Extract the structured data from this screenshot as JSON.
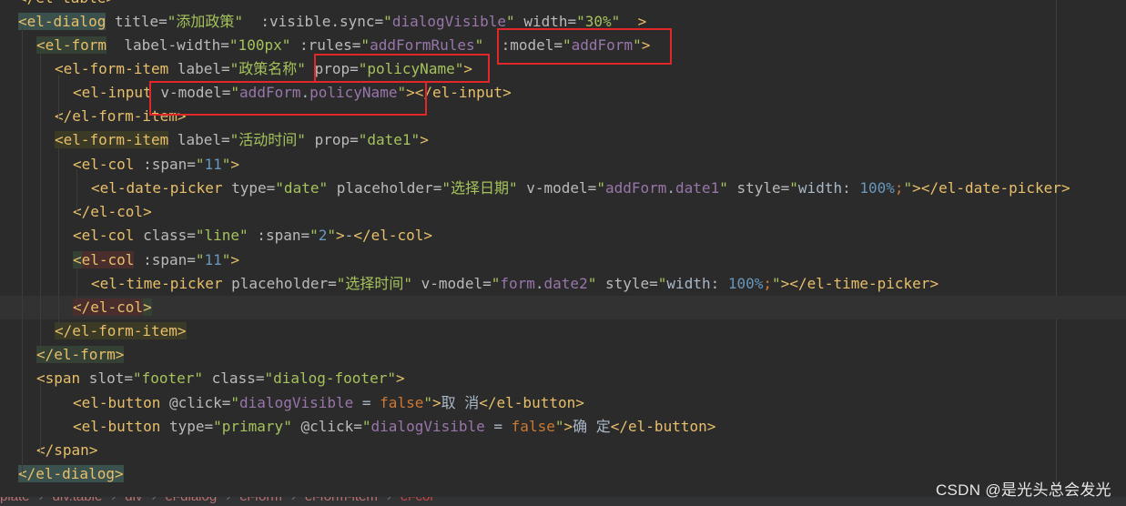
{
  "code_lines": [
    [
      [
        "tok-tag",
        "</el-table>"
      ]
    ],
    [
      [
        "tok-tag hl-match",
        "<el-dialog"
      ],
      [
        "tok-attr",
        " title="
      ],
      [
        "tok-val",
        "\"添加政策\""
      ],
      [
        "tok-attr",
        "  :visible.sync="
      ],
      [
        "tok-val",
        "\""
      ],
      [
        "tok-bind",
        "dialogVisible"
      ],
      [
        "tok-val",
        "\""
      ],
      [
        "tok-attr",
        " width="
      ],
      [
        "tok-val",
        "\"30%\""
      ],
      [
        "tok-attr",
        "  "
      ],
      [
        "tok-tag",
        ">"
      ]
    ],
    [
      [
        "tok-tag hl-green",
        "<el-form"
      ],
      [
        "tok-attr",
        "  label-width="
      ],
      [
        "tok-val",
        "\"100px\""
      ],
      [
        "tok-attr",
        " :rules="
      ],
      [
        "tok-val",
        "\""
      ],
      [
        "tok-bind",
        "addFormRules"
      ],
      [
        "tok-val",
        "\""
      ],
      [
        "tok-attr",
        "  :model="
      ],
      [
        "tok-val",
        "\""
      ],
      [
        "tok-bind",
        "addForm"
      ],
      [
        "tok-val",
        "\""
      ],
      [
        "tok-tag",
        ">"
      ]
    ],
    [
      [
        "tok-tag",
        "<el-form-item"
      ],
      [
        "tok-attr",
        " label="
      ],
      [
        "tok-val",
        "\"政策名称\""
      ],
      [
        "tok-attr",
        " prop="
      ],
      [
        "tok-val",
        "\"policyName\""
      ],
      [
        "tok-tag",
        ">"
      ]
    ],
    [
      [
        "tok-tag",
        "<el-input"
      ],
      [
        "tok-attr",
        " v-model="
      ],
      [
        "tok-val",
        "\""
      ],
      [
        "tok-bind",
        "addForm"
      ],
      [
        "tok-text",
        "."
      ],
      [
        "tok-bind",
        "policyName"
      ],
      [
        "tok-val",
        "\""
      ],
      [
        "tok-tag",
        ">"
      ],
      [
        "tok-tag",
        "</el-input>"
      ]
    ],
    [
      [
        "tok-tag",
        "</el-form-item>"
      ]
    ],
    [
      [
        "tok-tag hl-olive",
        "<el-form-item"
      ],
      [
        "tok-attr",
        " label="
      ],
      [
        "tok-val",
        "\"活动时间\""
      ],
      [
        "tok-attr",
        " prop="
      ],
      [
        "tok-val",
        "\"date1\""
      ],
      [
        "tok-tag",
        ">"
      ]
    ],
    [
      [
        "tok-tag",
        "<el-col"
      ],
      [
        "tok-attr",
        " :span="
      ],
      [
        "tok-val",
        "\""
      ],
      [
        "tok-num",
        "11"
      ],
      [
        "tok-val",
        "\""
      ],
      [
        "tok-tag",
        ">"
      ]
    ],
    [
      [
        "tok-tag",
        "<el-date-picker"
      ],
      [
        "tok-attr",
        " type="
      ],
      [
        "tok-val",
        "\"date\""
      ],
      [
        "tok-attr",
        " placeholder="
      ],
      [
        "tok-val",
        "\"选择日期\""
      ],
      [
        "tok-attr",
        " v-model="
      ],
      [
        "tok-val",
        "\""
      ],
      [
        "tok-bind",
        "addForm"
      ],
      [
        "tok-text",
        "."
      ],
      [
        "tok-bind",
        "date1"
      ],
      [
        "tok-val",
        "\""
      ],
      [
        "tok-attr",
        " style="
      ],
      [
        "tok-val",
        "\""
      ],
      [
        "tok-text",
        "width: "
      ],
      [
        "tok-num",
        "100%"
      ],
      [
        "tok-kw",
        ";"
      ],
      [
        "tok-val",
        "\""
      ],
      [
        "tok-tag",
        ">"
      ],
      [
        "tok-tag",
        "</el-date-picker>"
      ]
    ],
    [
      [
        "tok-tag",
        "</el-col>"
      ]
    ],
    [
      [
        "tok-tag",
        "<el-col"
      ],
      [
        "tok-attr",
        " class="
      ],
      [
        "tok-val",
        "\"line\""
      ],
      [
        "tok-attr",
        " :span="
      ],
      [
        "tok-val",
        "\""
      ],
      [
        "tok-num",
        "2"
      ],
      [
        "tok-val",
        "\""
      ],
      [
        "tok-tag",
        ">"
      ],
      [
        "tok-text",
        "-"
      ],
      [
        "tok-tag",
        "</el-col>"
      ]
    ],
    [
      [
        "tok-tag hl-green",
        "<"
      ],
      [
        "tok-tag hl-red",
        "el-col"
      ],
      [
        "tok-attr",
        " :span="
      ],
      [
        "tok-val",
        "\""
      ],
      [
        "tok-num",
        "11"
      ],
      [
        "tok-val",
        "\""
      ],
      [
        "tok-tag",
        ">"
      ]
    ],
    [
      [
        "tok-tag",
        "<el-time-picker"
      ],
      [
        "tok-attr",
        " placeholder="
      ],
      [
        "tok-val",
        "\"选择时间\""
      ],
      [
        "tok-attr",
        " v-model="
      ],
      [
        "tok-val",
        "\""
      ],
      [
        "tok-bind",
        "form"
      ],
      [
        "tok-text",
        "."
      ],
      [
        "tok-bind",
        "date2"
      ],
      [
        "tok-val",
        "\""
      ],
      [
        "tok-attr",
        " style="
      ],
      [
        "tok-val",
        "\""
      ],
      [
        "tok-text",
        "width: "
      ],
      [
        "tok-num",
        "100%"
      ],
      [
        "tok-kw",
        ";"
      ],
      [
        "tok-val",
        "\""
      ],
      [
        "tok-tag",
        ">"
      ],
      [
        "tok-tag",
        "</el-time-picker>"
      ]
    ],
    [
      [
        "tok-tag hl-red",
        "</el-col"
      ],
      [
        "tok-tag hl-green",
        ">"
      ]
    ],
    [
      [
        "tok-tag hl-olive",
        "</el-form-item>"
      ]
    ],
    [
      [
        "tok-tag hl-green",
        "</el-form>"
      ]
    ],
    [
      [
        "tok-tag",
        "<span"
      ],
      [
        "tok-attr",
        " slot="
      ],
      [
        "tok-val",
        "\"footer\""
      ],
      [
        "tok-attr",
        " class="
      ],
      [
        "tok-val",
        "\"dialog-footer\""
      ],
      [
        "tok-tag",
        ">"
      ]
    ],
    [
      [
        "tok-tag",
        "<el-button"
      ],
      [
        "tok-attr",
        " @click="
      ],
      [
        "tok-val",
        "\""
      ],
      [
        "tok-bind",
        "dialogVisible"
      ],
      [
        "tok-text",
        " = "
      ],
      [
        "tok-kw",
        "false"
      ],
      [
        "tok-val",
        "\""
      ],
      [
        "tok-tag",
        ">"
      ],
      [
        "tok-text",
        "取 消"
      ],
      [
        "tok-tag",
        "</el-button>"
      ]
    ],
    [
      [
        "tok-tag",
        "<el-button"
      ],
      [
        "tok-attr",
        " type="
      ],
      [
        "tok-val",
        "\"primary\""
      ],
      [
        "tok-attr",
        " @click="
      ],
      [
        "tok-val",
        "\""
      ],
      [
        "tok-bind",
        "dialogVisible"
      ],
      [
        "tok-text",
        " = "
      ],
      [
        "tok-kw",
        "false"
      ],
      [
        "tok-val",
        "\""
      ],
      [
        "tok-tag",
        ">"
      ],
      [
        "tok-text",
        "确 定"
      ],
      [
        "tok-tag",
        "</el-button>"
      ]
    ],
    [
      [
        "tok-tag",
        "</span>"
      ]
    ],
    [
      [
        "tok-tag hl-match",
        "</el-dialog>"
      ]
    ]
  ],
  "breadcrumb": [
    "plate",
    "div.table",
    "div",
    "el-dialog",
    "el-form",
    "el-form-item",
    "el-col"
  ],
  "watermark": "CSDN @是光头总会发光"
}
